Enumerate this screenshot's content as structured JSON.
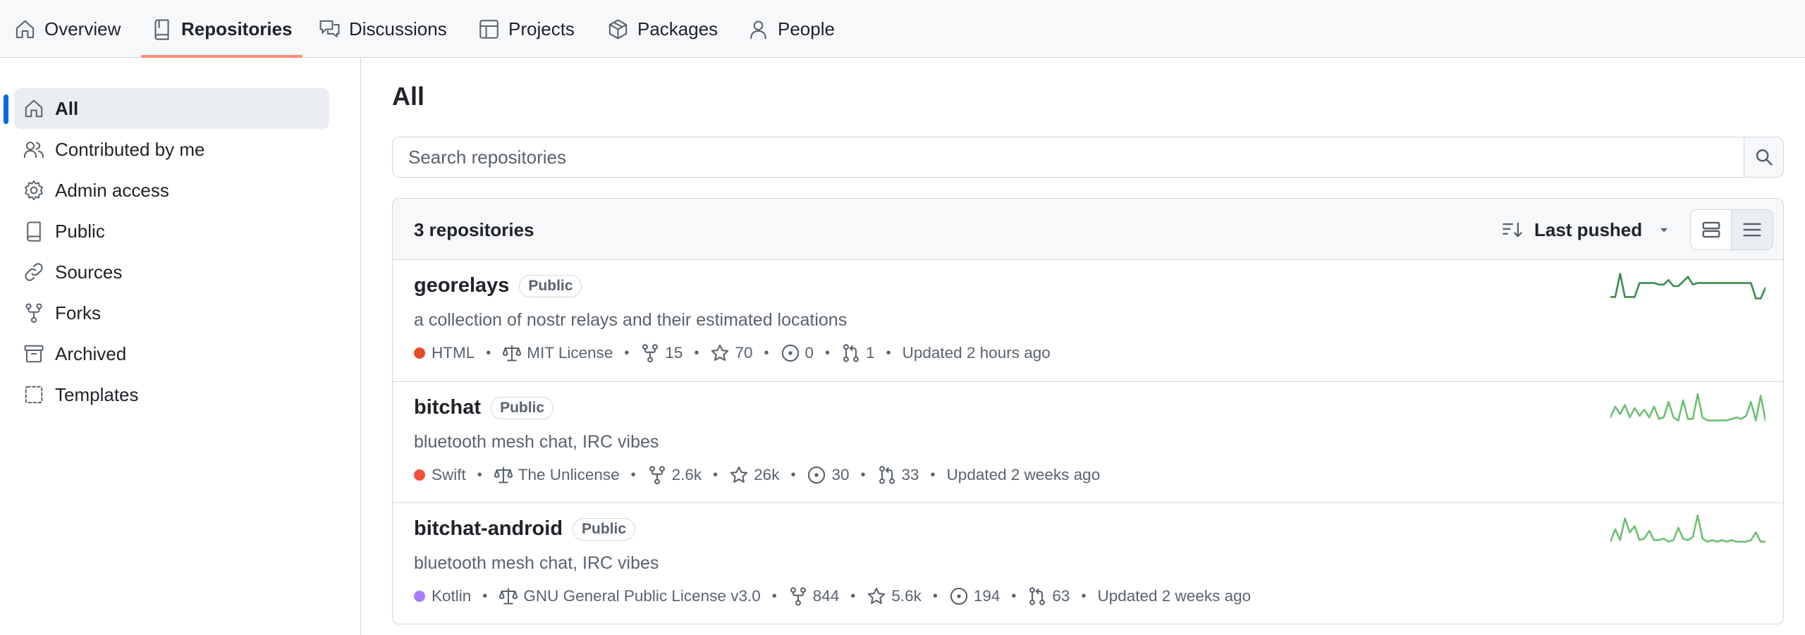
{
  "nav": {
    "tabs": [
      {
        "label": "Overview",
        "icon": "home-icon"
      },
      {
        "label": "Repositories",
        "icon": "repo-icon",
        "active": true
      },
      {
        "label": "Discussions",
        "icon": "discussions-icon"
      },
      {
        "label": "Projects",
        "icon": "table-icon"
      },
      {
        "label": "Packages",
        "icon": "package-icon"
      },
      {
        "label": "People",
        "icon": "person-icon"
      }
    ]
  },
  "sidebar": {
    "items": [
      {
        "label": "All",
        "icon": "home-icon",
        "active": true
      },
      {
        "label": "Contributed by me",
        "icon": "people-icon"
      },
      {
        "label": "Admin access",
        "icon": "gear-icon"
      },
      {
        "label": "Public",
        "icon": "repo-icon"
      },
      {
        "label": "Sources",
        "icon": "link-icon"
      },
      {
        "label": "Forks",
        "icon": "fork-icon"
      },
      {
        "label": "Archived",
        "icon": "archive-icon"
      },
      {
        "label": "Templates",
        "icon": "template-icon"
      }
    ]
  },
  "main": {
    "title": "All",
    "search_placeholder": "Search repositories",
    "count_label": "3 repositories",
    "sort_label": "Last pushed",
    "colors": {
      "accent": "#0969da",
      "tab_underline": "#fd8c73",
      "sparkline": "#2da44e"
    },
    "repos": [
      {
        "name": "georelays",
        "visibility": "Public",
        "description": "a collection of nostr relays and their estimated locations",
        "language": "HTML",
        "language_color": "#e34c26",
        "license": "MIT License",
        "forks": "15",
        "stars": "70",
        "issues": "0",
        "pulls": "1",
        "updated": "Updated 2 hours ago",
        "activity": [
          0.15,
          0.15,
          0.9,
          0.15,
          0.15,
          0.15,
          0.6,
          0.6,
          0.6,
          0.6,
          0.55,
          0.55,
          0.7,
          0.5,
          0.5,
          0.65,
          0.8,
          0.55,
          0.6,
          0.6,
          0.6,
          0.6,
          0.6,
          0.6,
          0.6,
          0.6,
          0.6,
          0.6,
          0.6,
          0.6,
          0.1,
          0.1,
          0.45
        ]
      },
      {
        "name": "bitchat",
        "visibility": "Public",
        "description": "bluetooth mesh chat, IRC vibes",
        "language": "Swift",
        "language_color": "#f05138",
        "license": "The Unlicense",
        "forks": "2.6k",
        "stars": "26k",
        "issues": "30",
        "pulls": "33",
        "updated": "Updated 2 weeks ago",
        "activity": [
          0.2,
          0.55,
          0.3,
          0.6,
          0.2,
          0.5,
          0.25,
          0.45,
          0.2,
          0.55,
          0.15,
          0.2,
          0.7,
          0.2,
          0.1,
          0.75,
          0.15,
          0.15,
          0.95,
          0.2,
          0.1,
          0.1,
          0.1,
          0.1,
          0.1,
          0.15,
          0.2,
          0.15,
          0.25,
          0.7,
          0.1,
          0.9,
          0.1
        ]
      },
      {
        "name": "bitchat-android",
        "visibility": "Public",
        "description": "bluetooth mesh chat, IRC vibes",
        "language": "Kotlin",
        "language_color": "#a97bff",
        "license": "GNU General Public License v3.0",
        "forks": "844",
        "stars": "5.6k",
        "issues": "194",
        "pulls": "63",
        "updated": "Updated 2 weeks ago",
        "activity": [
          0.1,
          0.5,
          0.15,
          0.85,
          0.4,
          0.6,
          0.15,
          0.2,
          0.45,
          0.15,
          0.15,
          0.2,
          0.1,
          0.15,
          0.55,
          0.2,
          0.15,
          0.25,
          0.95,
          0.2,
          0.1,
          0.15,
          0.1,
          0.15,
          0.1,
          0.15,
          0.1,
          0.1,
          0.1,
          0.15,
          0.4,
          0.1,
          0.1
        ]
      }
    ]
  }
}
